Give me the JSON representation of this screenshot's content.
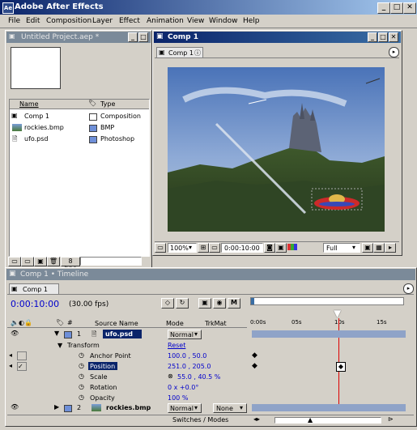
{
  "app": {
    "title": "Adobe After Effects",
    "window_buttons": [
      "_",
      "□",
      "✕"
    ]
  },
  "menu": [
    "File",
    "Edit",
    "Composition",
    "Layer",
    "Effect",
    "Animation",
    "View",
    "Window",
    "Help"
  ],
  "project": {
    "title": "Untitled Project.aep *",
    "columns": [
      "Name",
      "Type"
    ],
    "items": [
      {
        "name": "Comp 1",
        "type": "Composition",
        "icon": "comp-icon",
        "color": "#ffffff"
      },
      {
        "name": "rockies.bmp",
        "type": "BMP",
        "icon": "image-icon",
        "color": "#6e8fd8"
      },
      {
        "name": "ufo.psd",
        "type": "Photoshop",
        "icon": "psd-icon",
        "color": "#6e8fd8"
      }
    ],
    "bpc_label": "8 bpc"
  },
  "comp": {
    "title": "Comp 1",
    "tab": "Comp 1",
    "zoom": "100%",
    "timecode": "0:00:10:00",
    "resolution": "Full"
  },
  "timeline": {
    "title": "Comp 1 • Timeline",
    "tab": "Comp 1",
    "current_time": "0:00:10:00",
    "fps": "(30.00 fps)",
    "col_source": "Source Name",
    "col_mode": "Mode",
    "col_trkmat": "TrkMat",
    "ruler": [
      "0:00s",
      "05s",
      "10s",
      "15s"
    ],
    "layers": [
      {
        "num": "1",
        "name": "ufo.psd",
        "mode": "Normal",
        "trkmat": ""
      },
      {
        "num": "2",
        "name": "rockies.bmp",
        "mode": "Normal",
        "trkmat": "None"
      }
    ],
    "transform": {
      "label": "Transform",
      "reset": "Reset",
      "props": [
        {
          "name": "Anchor Point",
          "value": "100.0 , 50.0"
        },
        {
          "name": "Position",
          "value": "251.0 , 205.0"
        },
        {
          "name": "Scale",
          "value": "55.0 , 40.5 %"
        },
        {
          "name": "Rotation",
          "value": "0 x +0.0°"
        },
        {
          "name": "Opacity",
          "value": "100 %"
        }
      ]
    },
    "footer": "Switches / Modes"
  }
}
